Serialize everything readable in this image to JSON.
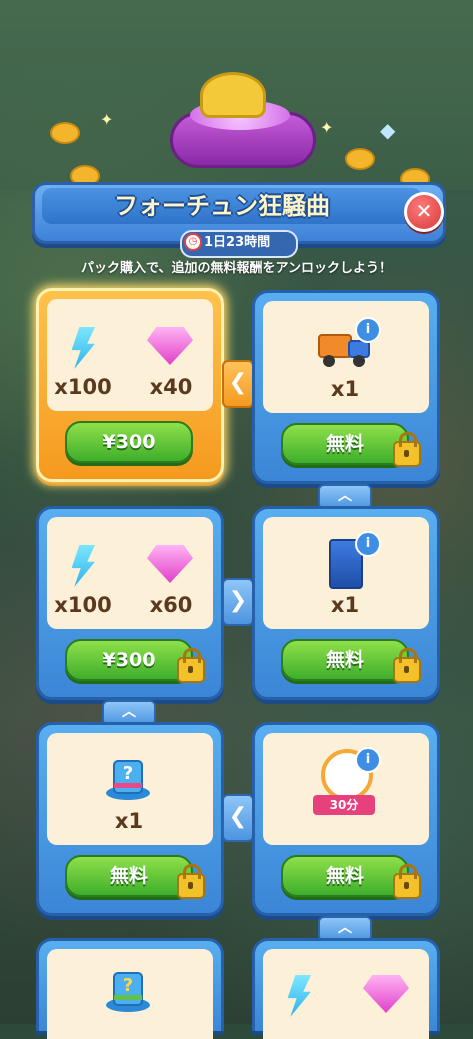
{
  "header": {
    "title": "フォーチュン狂騒曲",
    "timer": "1日23時間",
    "subtitle": "パック購入で、追加の無料報酬をアンロックしよう！"
  },
  "close_label": "✕",
  "cards": [
    {
      "items": [
        {
          "icon": "energy-icon",
          "qty": "x100"
        },
        {
          "icon": "gem-icon",
          "qty": "x40"
        }
      ],
      "button": "¥300"
    },
    {
      "items": [
        {
          "icon": "truck-icon",
          "qty": "x1"
        }
      ],
      "button": "無料"
    },
    {
      "items": [
        {
          "icon": "energy-icon",
          "qty": "x100"
        },
        {
          "icon": "gem-icon",
          "qty": "x60"
        }
      ],
      "button": "¥300"
    },
    {
      "items": [
        {
          "icon": "ticket-icon",
          "qty": "x1"
        }
      ],
      "button": "無料"
    },
    {
      "items": [
        {
          "icon": "mystery-hat-icon",
          "qty": "x1"
        }
      ],
      "button": "無料"
    },
    {
      "items": [
        {
          "icon": "stopwatch-icon",
          "qty": "30分"
        }
      ],
      "button": "無料"
    }
  ],
  "arrows": {
    "left": "❮",
    "right": "❯",
    "up": "︿"
  }
}
